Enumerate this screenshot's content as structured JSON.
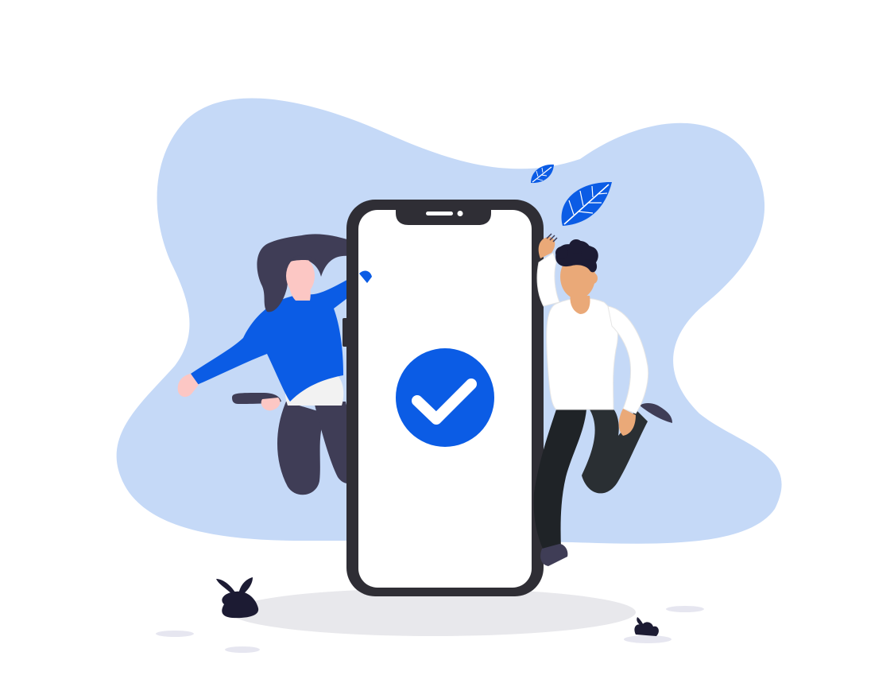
{
  "illustration": {
    "subject": "phone-verification-success",
    "icons": [
      "check-circle-icon",
      "leaf-icon",
      "plant-icon"
    ],
    "colors": {
      "background": "#ffffff",
      "blob": "#c5d9f7",
      "accent": "#0b5ce5",
      "phone_frame": "#2f2e35",
      "phone_screen": "#ffffff",
      "check_mark": "#ffffff",
      "shadow": "#e8e8ec",
      "ground_patch": "#e6e6f0",
      "woman_hair": "#3f3d56",
      "woman_skin": "#fcc7c4",
      "woman_top": "#0b5ce5",
      "woman_pants": "#3f3d56",
      "man_hair": "#1c1b33",
      "man_skin": "#eaa978",
      "man_shirt": "#ffffff",
      "man_pants": "#2a2f33",
      "plant": "#1c1b33"
    }
  }
}
